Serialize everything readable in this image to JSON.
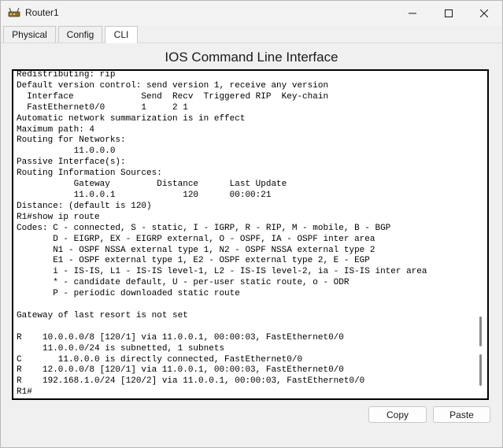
{
  "window": {
    "title": "Router1",
    "controls": {
      "minimize_icon": "minimize-icon",
      "maximize_icon": "maximize-icon",
      "close_icon": "close-icon"
    }
  },
  "tabs": [
    {
      "label": "Physical",
      "active": false
    },
    {
      "label": "Config",
      "active": false
    },
    {
      "label": "CLI",
      "active": true
    }
  ],
  "cli": {
    "heading": "IOS Command Line Interface",
    "output": "Redistributing: rip\nDefault version control: send version 1, receive any version\n  Interface             Send  Recv  Triggered RIP  Key-chain\n  FastEthernet0/0       1     2 1\nAutomatic network summarization is in effect\nMaximum path: 4\nRouting for Networks:\n           11.0.0.0\nPassive Interface(s):\nRouting Information Sources:\n           Gateway         Distance      Last Update\n           11.0.0.1             120      00:00:21\nDistance: (default is 120)\nR1#show ip route\nCodes: C - connected, S - static, I - IGRP, R - RIP, M - mobile, B - BGP\n       D - EIGRP, EX - EIGRP external, O - OSPF, IA - OSPF inter area\n       N1 - OSPF NSSA external type 1, N2 - OSPF NSSA external type 2\n       E1 - OSPF external type 1, E2 - OSPF external type 2, E - EGP\n       i - IS-IS, L1 - IS-IS level-1, L2 - IS-IS level-2, ia - IS-IS inter area\n       * - candidate default, U - per-user static route, o - ODR\n       P - periodic downloaded static route\n\nGateway of last resort is not set\n\nR    10.0.0.0/8 [120/1] via 11.0.0.1, 00:00:03, FastEthernet0/0\n     11.0.0.0/24 is subnetted, 1 subnets\nC       11.0.0.0 is directly connected, FastEthernet0/0\nR    12.0.0.0/8 [120/1] via 11.0.0.1, 00:00:03, FastEthernet0/0\nR    192.168.1.0/24 [120/2] via 11.0.0.1, 00:00:03, FastEthernet0/0\nR1#"
  },
  "buttons": {
    "copy": "Copy",
    "paste": "Paste"
  }
}
